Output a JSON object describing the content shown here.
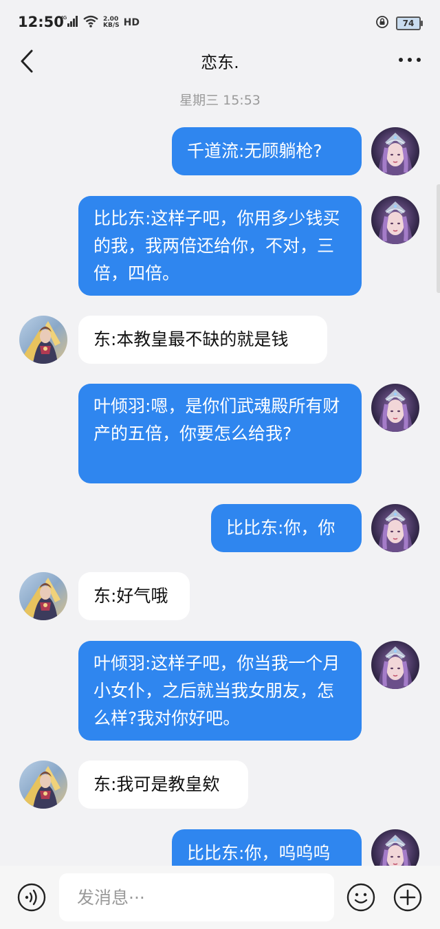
{
  "status_bar": {
    "time": "12:50",
    "network": "4G",
    "speed_value": "2.00",
    "speed_unit": "KB/S",
    "hd": "HD",
    "battery": "74"
  },
  "header": {
    "title": "恋东."
  },
  "chat": {
    "timestamp": "星期三 15:53",
    "messages": [
      {
        "side": "out",
        "text": "千道流:无顾躺枪?"
      },
      {
        "side": "out",
        "text": "比比东:这样子吧，你用多少钱买的我，我两倍还给你，不对，三倍，四倍。"
      },
      {
        "side": "in",
        "text": "东:本教皇最不缺的就是钱"
      },
      {
        "side": "out",
        "text": "叶倾羽:嗯，是你们武魂殿所有财产的五倍，你要怎么给我?"
      },
      {
        "side": "out",
        "text": "比比东:你，你"
      },
      {
        "side": "in",
        "text": "东:好气哦"
      },
      {
        "side": "out",
        "text": "叶倾羽:这样子吧，你当我一个月小女仆，之后就当我女朋友，怎么样?我对你好吧。"
      },
      {
        "side": "in",
        "text": "东:我可是教皇欸"
      },
      {
        "side": "out",
        "text": "比比东:你，呜呜呜"
      }
    ]
  },
  "input_bar": {
    "placeholder": "发消息···"
  },
  "colors": {
    "accent": "#2f86ef",
    "background": "#f2f2f4"
  }
}
